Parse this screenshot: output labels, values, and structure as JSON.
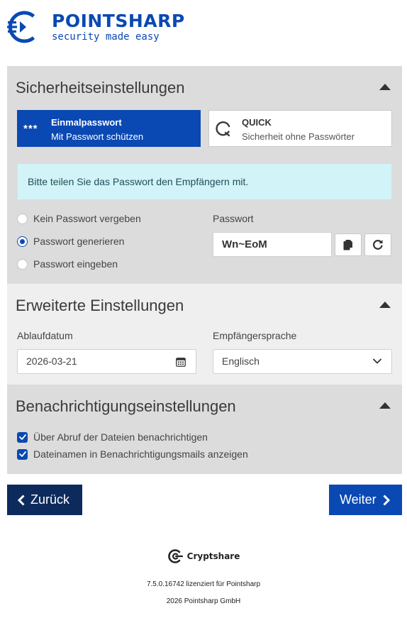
{
  "brand": {
    "name": "POINTSHARP",
    "tagline": "security made easy",
    "color": "#0a49b3"
  },
  "security": {
    "title": "Sicherheitseinstellungen",
    "modes": [
      {
        "icon": "***",
        "title": "Einmalpasswort",
        "subtitle": "Mit Passwort schützen",
        "selected": true
      },
      {
        "icon": "quick-icon",
        "title": "QUICK",
        "subtitle": "Sicherheit ohne Passwörter",
        "selected": false
      }
    ],
    "info": "Bitte teilen Sie das Passwort den Empfängern mit.",
    "options": [
      {
        "label": "Kein Passwort vergeben",
        "checked": false
      },
      {
        "label": "Passwort generieren",
        "checked": true
      },
      {
        "label": "Passwort eingeben",
        "checked": false
      }
    ],
    "password_label": "Passwort",
    "password_value": "Wn~EoM"
  },
  "advanced": {
    "title": "Erweiterte Einstellungen",
    "expiry_label": "Ablaufdatum",
    "expiry_value": "2026-03-21",
    "language_label": "Empfängersprache",
    "language_value": "Englisch"
  },
  "notify": {
    "title": "Benachrichtigungseinstellungen",
    "options": [
      {
        "label": "Über Abruf der Dateien benachrichtigen",
        "checked": true
      },
      {
        "label": "Dateinamen in Benachrichtigungsmails anzeigen",
        "checked": true
      }
    ]
  },
  "nav": {
    "back_label": "Zurück",
    "next_label": "Weiter"
  },
  "footer": {
    "product": "Cryptshare",
    "version": "7.5.0.16742 lizenziert für Pointsharp",
    "copyright": "2026 Pointsharp GmbH"
  }
}
